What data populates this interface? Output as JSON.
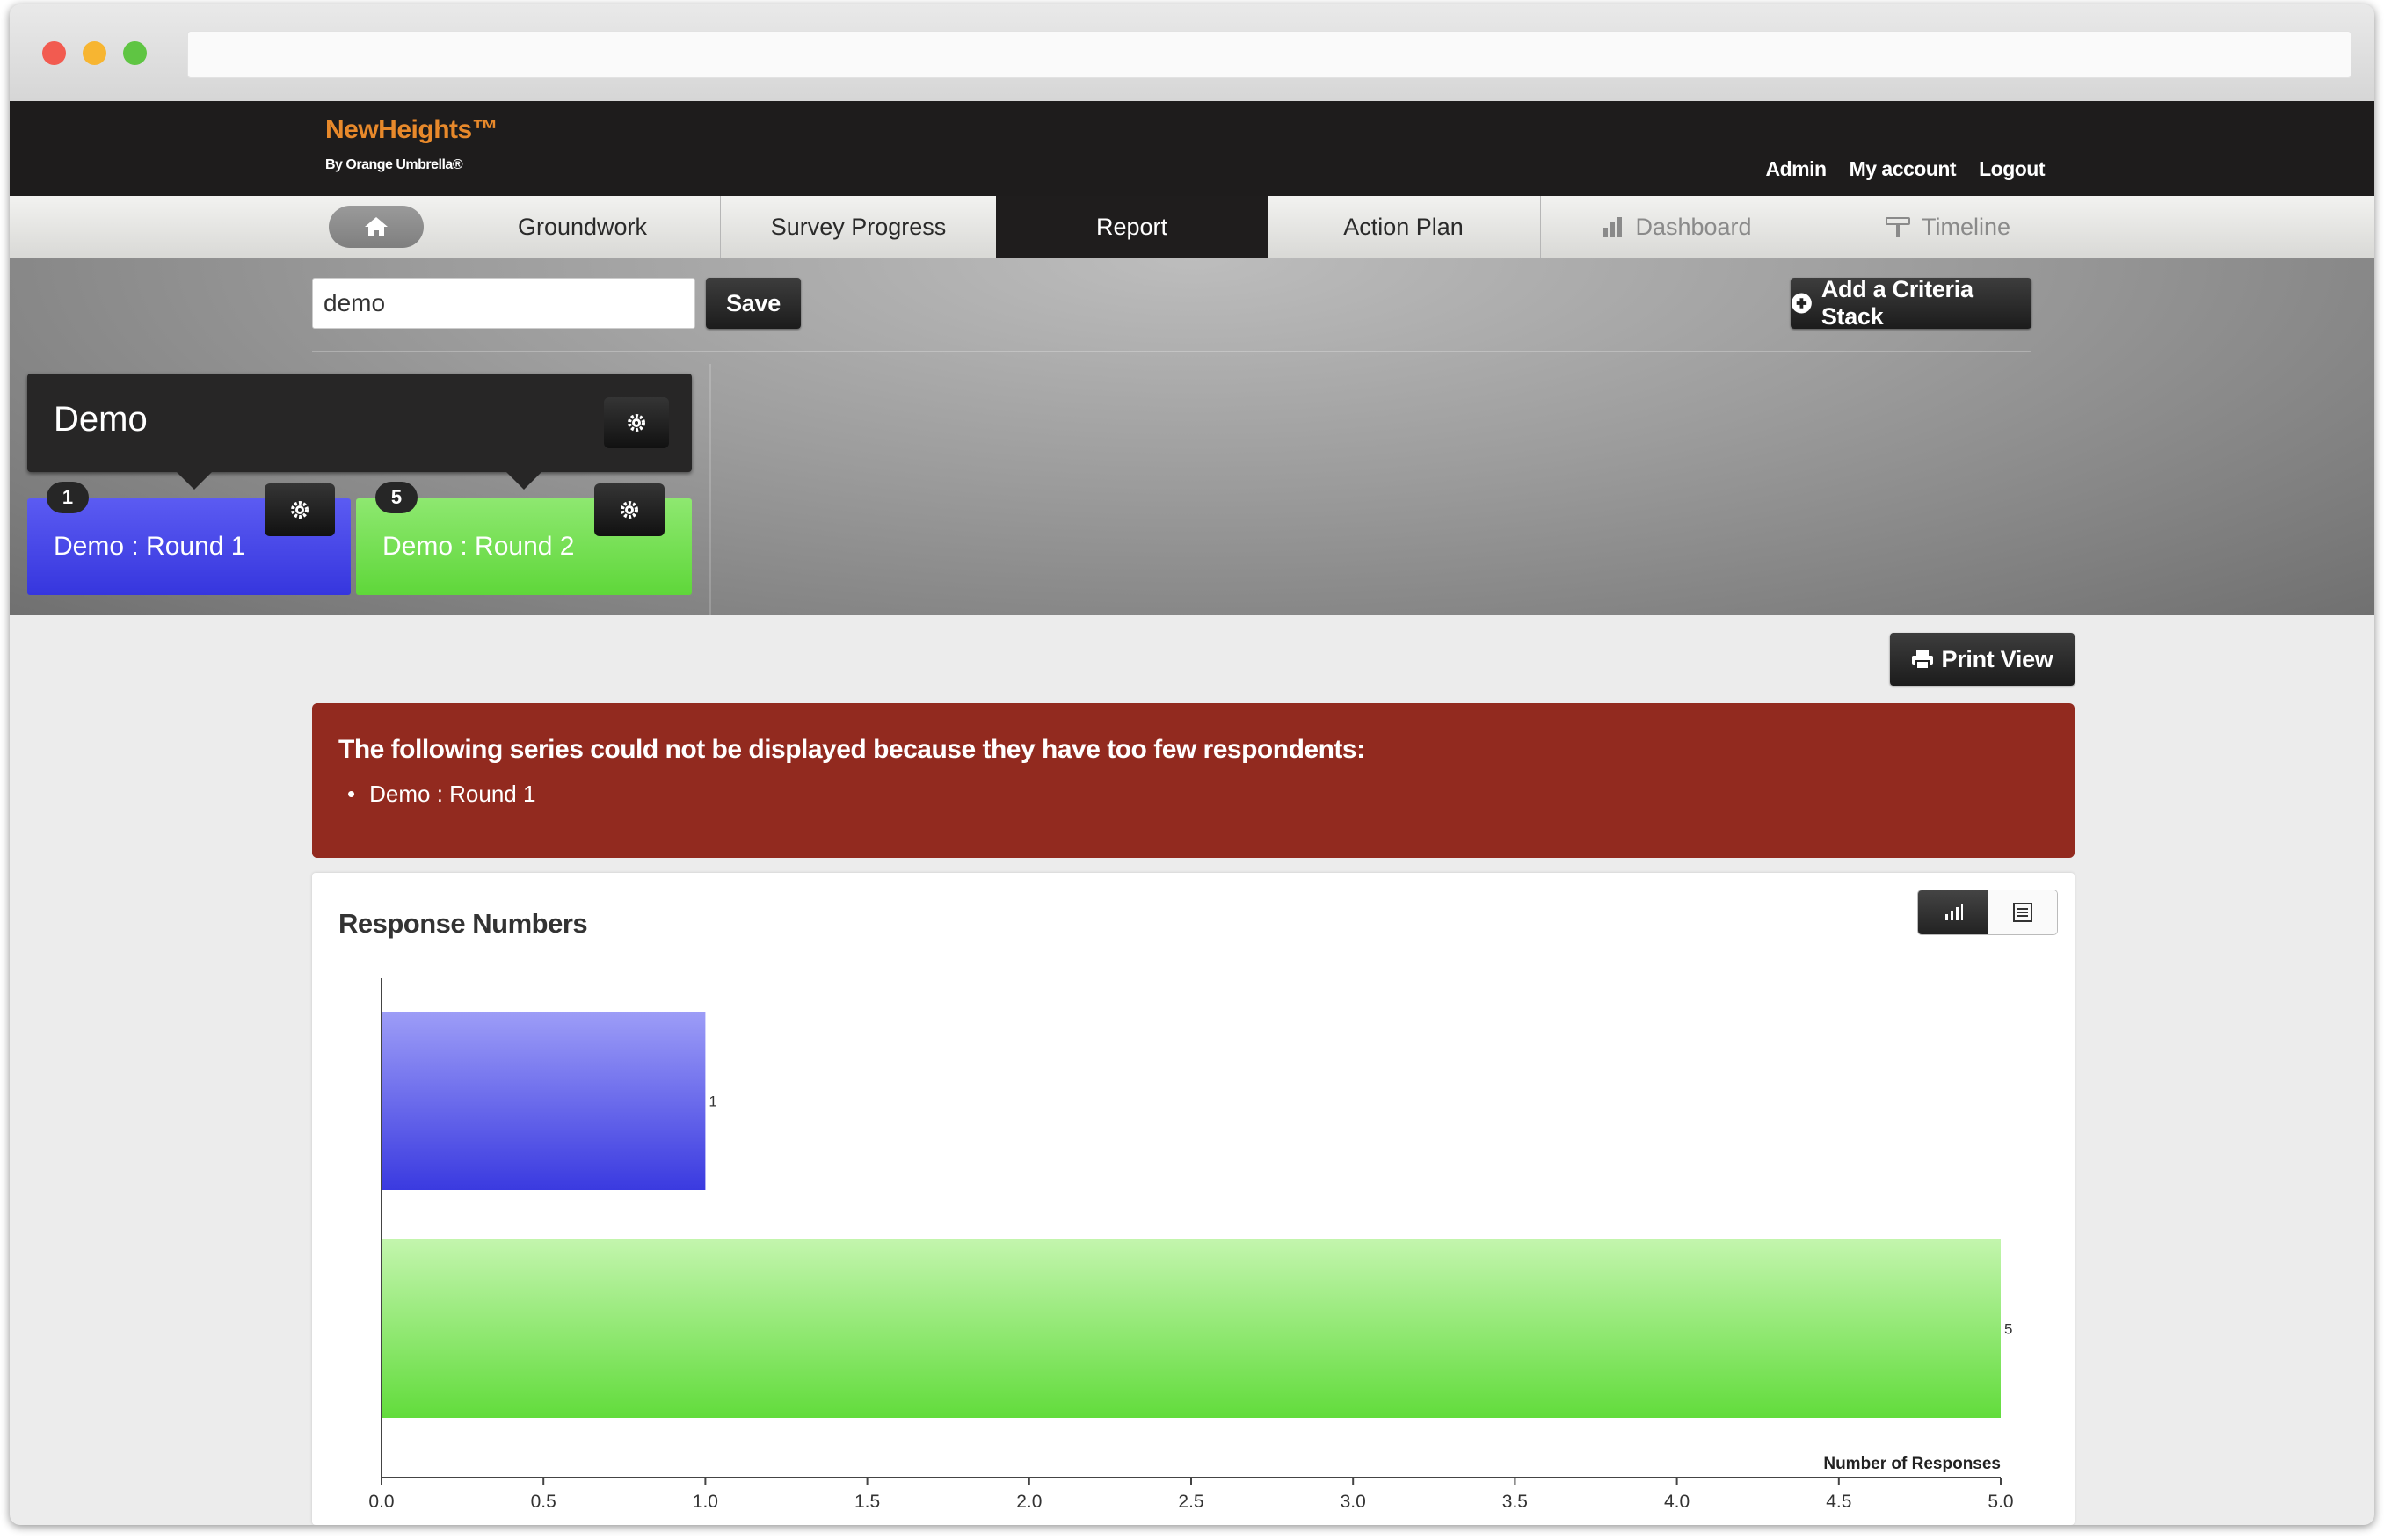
{
  "brand": {
    "name": "NewHeights™",
    "tagline": "By Orange Umbrella®"
  },
  "user_links": [
    "Admin",
    "My account",
    "Logout"
  ],
  "nav": {
    "home_icon": "home-icon",
    "tabs": [
      "Groundwork",
      "Survey Progress",
      "Report",
      "Action Plan",
      "Dashboard",
      "Timeline"
    ],
    "active_tab": "Report"
  },
  "criteria": {
    "name_value": "demo",
    "save_label": "Save",
    "add_stack_label": "Add a Criteria Stack",
    "stack": {
      "title": "Demo",
      "series": [
        {
          "label": "Demo : Round 1",
          "count": "1",
          "color": "#4545e6"
        },
        {
          "label": "Demo : Round 2",
          "count": "5",
          "color": "#6ade45"
        }
      ]
    }
  },
  "print_label": "Print View",
  "alert": {
    "title": "The following series could not be displayed because they have too few respondents:",
    "items": [
      "Demo : Round 1"
    ],
    "color": "#922a1f"
  },
  "card": {
    "title": "Response Numbers"
  },
  "chart_data": {
    "type": "bar",
    "orientation": "horizontal",
    "categories": [
      "Demo : Round 1",
      "Demo : Round 2"
    ],
    "values": [
      1,
      5
    ],
    "value_labels": [
      "1",
      "5"
    ],
    "colors": [
      "#4545e6",
      "#6ade45"
    ],
    "xlabel": "Number of Responses",
    "xlim": [
      0,
      5
    ],
    "xticks": [
      "0.0",
      "0.5",
      "1.0",
      "1.5",
      "2.0",
      "2.5",
      "3.0",
      "3.5",
      "4.0",
      "4.5",
      "5.0"
    ],
    "grid": false
  }
}
